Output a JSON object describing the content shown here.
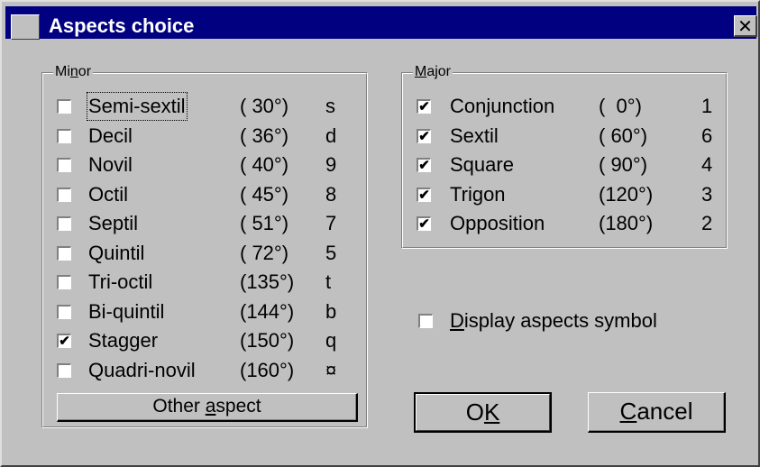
{
  "window": {
    "title": "Aspects choice",
    "close_glyph": "✕"
  },
  "minor": {
    "legend_pre": "Mi",
    "legend_key": "n",
    "legend_post": "or",
    "items": [
      {
        "label": "Semi-sextil",
        "angle": "( 30°)",
        "key": "s",
        "checked": false
      },
      {
        "label": "Decil",
        "angle": "( 36°)",
        "key": "d",
        "checked": false
      },
      {
        "label": "Novil",
        "angle": "( 40°)",
        "key": "9",
        "checked": false
      },
      {
        "label": "Octil",
        "angle": "( 45°)",
        "key": "8",
        "checked": false
      },
      {
        "label": "Septil",
        "angle": "( 51°)",
        "key": "7",
        "checked": false
      },
      {
        "label": "Quintil",
        "angle": "( 72°)",
        "key": "5",
        "checked": false
      },
      {
        "label": "Tri-octil",
        "angle": "(135°)",
        "key": "t",
        "checked": false
      },
      {
        "label": "Bi-quintil",
        "angle": "(144°)",
        "key": "b",
        "checked": false
      },
      {
        "label": "Stagger",
        "angle": "(150°)",
        "key": "q",
        "checked": true
      },
      {
        "label": "Quadri-novil",
        "angle": "(160°)",
        "key": "¤",
        "checked": false
      }
    ],
    "other_pre": "Other ",
    "other_key": "a",
    "other_post": "spect"
  },
  "major": {
    "legend_key": "M",
    "legend_post": "ajor",
    "items": [
      {
        "label": "Conjunction",
        "angle": "(  0°)",
        "key": "1",
        "checked": true
      },
      {
        "label": "Sextil",
        "angle": "( 60°)",
        "key": "6",
        "checked": true
      },
      {
        "label": "Square",
        "angle": "( 90°)",
        "key": "4",
        "checked": true
      },
      {
        "label": "Trigon",
        "angle": "(120°)",
        "key": "3",
        "checked": true
      },
      {
        "label": "Opposition",
        "angle": "(180°)",
        "key": "2",
        "checked": true
      }
    ]
  },
  "display_symbol": {
    "key": "D",
    "label_post": "isplay aspects symbol",
    "checked": false
  },
  "ok": {
    "pre": "O",
    "key": "K"
  },
  "cancel": {
    "key": "C",
    "post": "ancel"
  },
  "check_glyph": "✔"
}
